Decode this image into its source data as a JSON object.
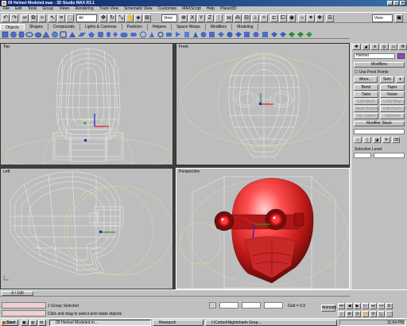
{
  "window": {
    "title": "09 Helmet Modeled.max - 3D Studio MAX R3.1",
    "controls": [
      "_",
      "□",
      "×"
    ]
  },
  "menu": [
    "File",
    "Edit",
    "Tools",
    "Group",
    "Views",
    "Rendering",
    "Track View",
    "Schematic View",
    "Customize",
    "MAXScript",
    "Help",
    "Planet3D"
  ],
  "toolbar": {
    "selection_filter": "All",
    "reference_coord": "View",
    "named_selection": "",
    "view_dropdown": "View"
  },
  "tab_panel": [
    "Objects",
    "Shapes",
    "Compounds",
    "Lights & Cameras",
    "Particles",
    "Helpers",
    "Space Warps",
    "Modifiers",
    "Modeling"
  ],
  "viewports": {
    "top": "Top",
    "front": "Front",
    "left": "Left",
    "perspective": "Perspective"
  },
  "command_panel": {
    "object_name": "Helmet",
    "modifiers_rollout": "Modifiers",
    "use_pivot_points": "Use Pivot Points",
    "buttons": [
      "More...",
      "Sets",
      "Bend",
      "Taper",
      "Twist",
      "Noise",
      "Edit Mesh",
      "UVW Map",
      "Mesh Select",
      "Edit Patch",
      "Vol. Select",
      "Optimize"
    ],
    "modifier_stack": "Modifier Stack",
    "selection_level": "Selection Level:"
  },
  "time_slider": "0 / 100",
  "status": {
    "selected": "1 Group Selected",
    "prompt": "Click and drag to select and rotate objects",
    "grid": "Grid = 0.0",
    "animate": "Animate"
  },
  "taskbar": {
    "start": "Start",
    "tasks": [
      "09 Helmet Modeled.m...",
      "Research",
      "I:\\Corbet\\Nightshade Grap..."
    ],
    "clock": "11:04 PM"
  }
}
